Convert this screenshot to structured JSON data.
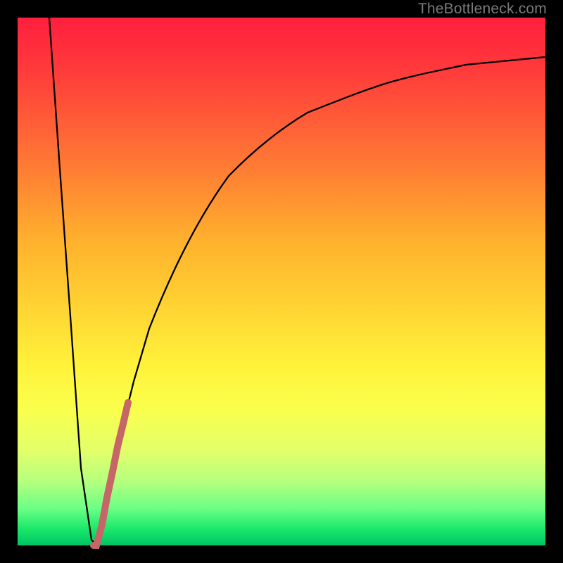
{
  "watermark": "TheBottleneck.com",
  "colors": {
    "frame": "#000000",
    "curve_main": "#000000",
    "curve_accent": "#c76666",
    "gradient_top": "#ff1f3e",
    "gradient_bottom": "#00c565"
  },
  "chart_data": {
    "type": "line",
    "title": "",
    "xlabel": "",
    "ylabel": "",
    "xlim": [
      0,
      100
    ],
    "ylim": [
      0,
      100
    ],
    "grid": false,
    "legend": false,
    "series": [
      {
        "name": "main-curve",
        "x": [
          6,
          8,
          10,
          12,
          14,
          15,
          16,
          18,
          20,
          22,
          25,
          30,
          35,
          40,
          45,
          50,
          55,
          60,
          65,
          70,
          75,
          80,
          85,
          90,
          95,
          100
        ],
        "y": [
          100,
          71,
          43,
          14,
          1,
          0,
          4,
          14,
          23,
          31,
          41,
          54,
          63,
          70,
          75,
          79,
          82,
          84,
          86,
          88,
          89,
          90,
          91,
          91.5,
          92,
          92.5
        ]
      },
      {
        "name": "accent-segment",
        "x": [
          14.5,
          15,
          16,
          17,
          18,
          19,
          20,
          21
        ],
        "y": [
          0,
          0,
          4,
          9,
          14,
          19,
          23,
          27
        ]
      }
    ],
    "min_point": {
      "x": 15,
      "y": 0
    }
  }
}
